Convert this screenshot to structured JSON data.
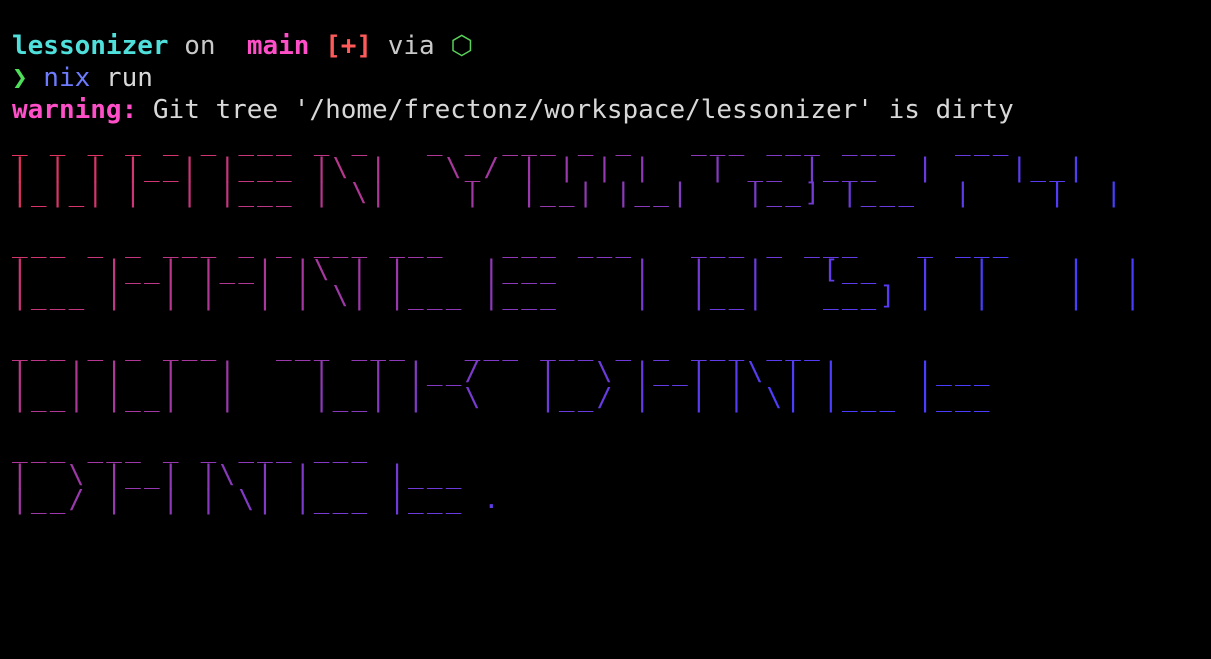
{
  "prompt_line": {
    "dir": "lessonizer",
    "on": " on ",
    "branch_icon": "",
    "branch": " main",
    "status": " [+]",
    "via": " via ",
    "runtime_icon": "⬡"
  },
  "command_line": {
    "prompt_char": "❯",
    "cmd": " nix",
    "args": " run"
  },
  "warning_line": {
    "label": "warning:",
    "message": " Git tree '/home/frectonz/workspace/lessonizer' is dirty"
  },
  "colors": {
    "background": "#000000",
    "dir": "#4fe0dc",
    "branch": "#ff4fc8",
    "status": "#ff5a5a",
    "warning": "#ff4fc8",
    "art_start": "#e8345a",
    "art_end": "#4a3dff"
  },
  "ascii_art": [
    "_ _ _ _ _ _ ___ _ _   _ _ ___ _ _   ___ ___ ___   ___",
    "| | | |__| |___ |\\ |   \\_/ | | | |   | __ |___  |    |__|",
    "|_|_| |  | |___ | \\|    |  |__| |__|   |__] |___  |    |  |",
    "",
    "___ _ _ ___ _ _ ___ ___   ___ ___   ___ _ ___   _ ___",
    "|    |__| |__| |\\ | |    |___    |  |  |   [__  |  |    |  |",
    "|___ |  | |  | | \\| |___ |___    |  |__|   ___] |  |    |  |",
    "",
    "___ _ _ ___   ___ ___   ___ ___ _ _ ___ ___",
    "|  | |  |  |    |  | |__/   |  \\ |__| |\\ | |    |___",
    "|__| |__|  |    |__| |  \\   |__/ |  | | \\| |___ |___",
    "",
    "___ ___ _ _ ___ ___",
    "|  \\ |__| |\\ | |    |___",
    "|__/ |  | | \\| |___ |___ ."
  ]
}
